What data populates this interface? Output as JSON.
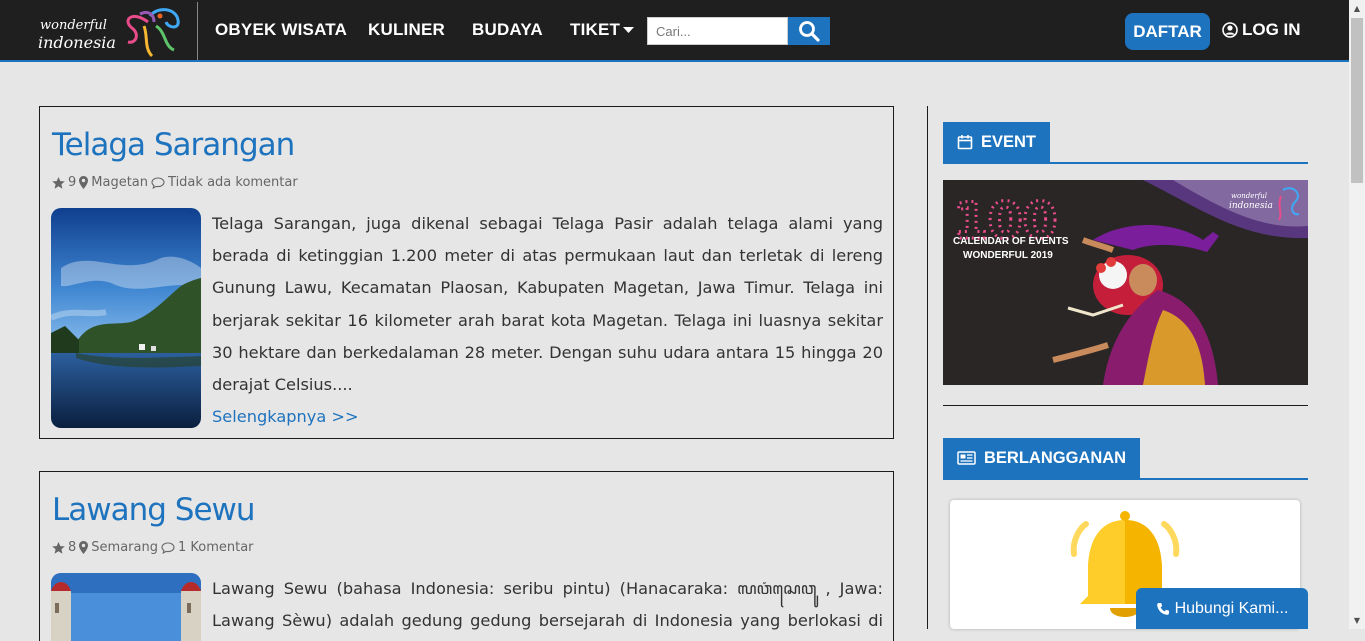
{
  "brand": {
    "logo_line1": "wonderful",
    "logo_line2": "indonesia"
  },
  "nav": {
    "items": [
      {
        "label": "OBYEK WISATA"
      },
      {
        "label": "KULINER"
      },
      {
        "label": "BUDAYA"
      },
      {
        "label": "TIKET"
      }
    ],
    "search_placeholder": "Cari...",
    "register_label": "DAFTAR",
    "login_label": "LOG IN"
  },
  "posts": [
    {
      "title": "Telaga Sarangan",
      "rating": "9",
      "location": "Magetan",
      "comments": "Tidak ada komentar",
      "excerpt": "Telaga Sarangan, juga dikenal sebagai Telaga Pasir adalah telaga alami yang berada di ketinggian 1.200 meter di atas permukaan laut dan terletak di lereng Gunung Lawu, Kecamatan Plaosan, Kabupaten Magetan, Jawa Timur. Telaga ini berjarak sekitar 16 kilometer arah barat kota Magetan. Telaga ini luasnya sekitar 30 hektare dan berkedalaman 28 meter. Dengan suhu udara antara 15 hingga 20 derajat Celsius....",
      "read_more": "Selengkapnya >>"
    },
    {
      "title": "Lawang Sewu",
      "rating": "8",
      "location": "Semarang",
      "comments": "1 Komentar",
      "excerpt": "Lawang Sewu (bahasa Indonesia: seribu pintu) (Hanacaraka: ꦭꦮꦁꦱꦺꦮꦸ , Jawa: Lawang Sèwu) adalah gedung gedung bersejarah di Indonesia yang berlokasi di Kota Semarang,"
    }
  ],
  "sidebar": {
    "event_title": "EVENT",
    "event_banner": {
      "number": "100",
      "caption_line1": "CALENDAR OF EVENTS",
      "caption_line2": "WONDERFUL 2019",
      "logo_line1": "wonderful",
      "logo_line2": "indonesia"
    },
    "subscribe_title": "BERLANGGANAN"
  },
  "contact_button": "Hubungi Kami...",
  "colors": {
    "accent": "#1e73be",
    "topbar": "#1f1f1f",
    "page_bg": "#e6e6e6"
  },
  "icons": {
    "rating": "star-icon",
    "location": "map-marker-icon",
    "comments": "comment-icon",
    "search": "search-icon",
    "login": "user-circle-icon",
    "event": "calendar-icon",
    "subscribe": "newspaper-icon",
    "contact": "phone-icon",
    "dropdown": "caret-down-icon",
    "notification": "bell-icon"
  }
}
